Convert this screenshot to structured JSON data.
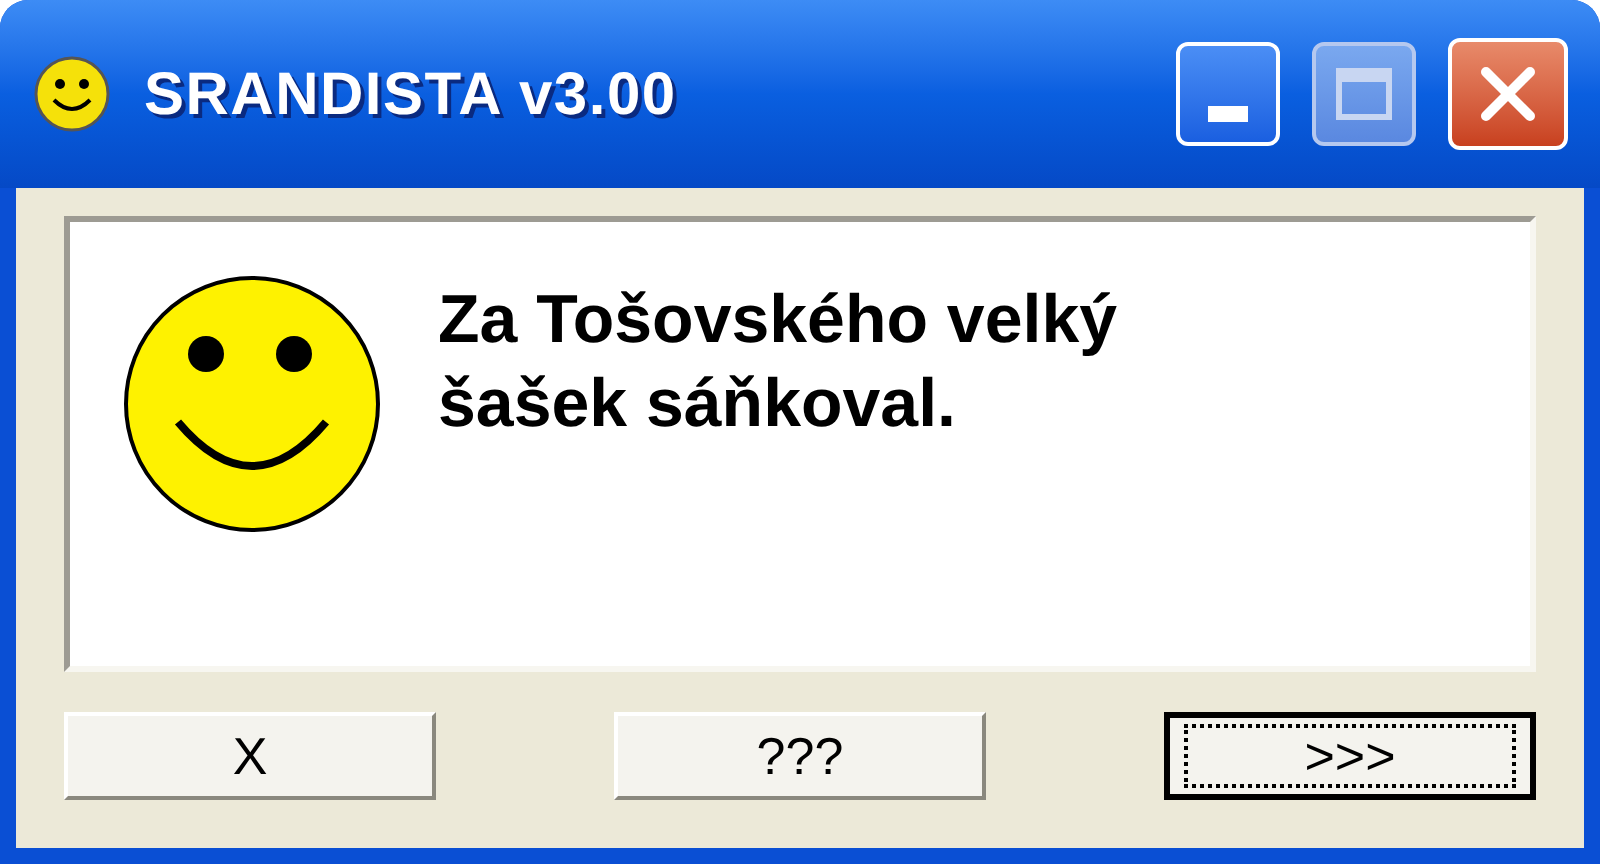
{
  "window": {
    "title": "SRANDISTA v3.00"
  },
  "message": {
    "lines": [
      "Za Tošovského velký",
      "šašek sáňkoval."
    ]
  },
  "buttons": [
    {
      "label": "X",
      "focused": false
    },
    {
      "label": "???",
      "focused": false
    },
    {
      "label": ">>>",
      "focused": true
    }
  ]
}
